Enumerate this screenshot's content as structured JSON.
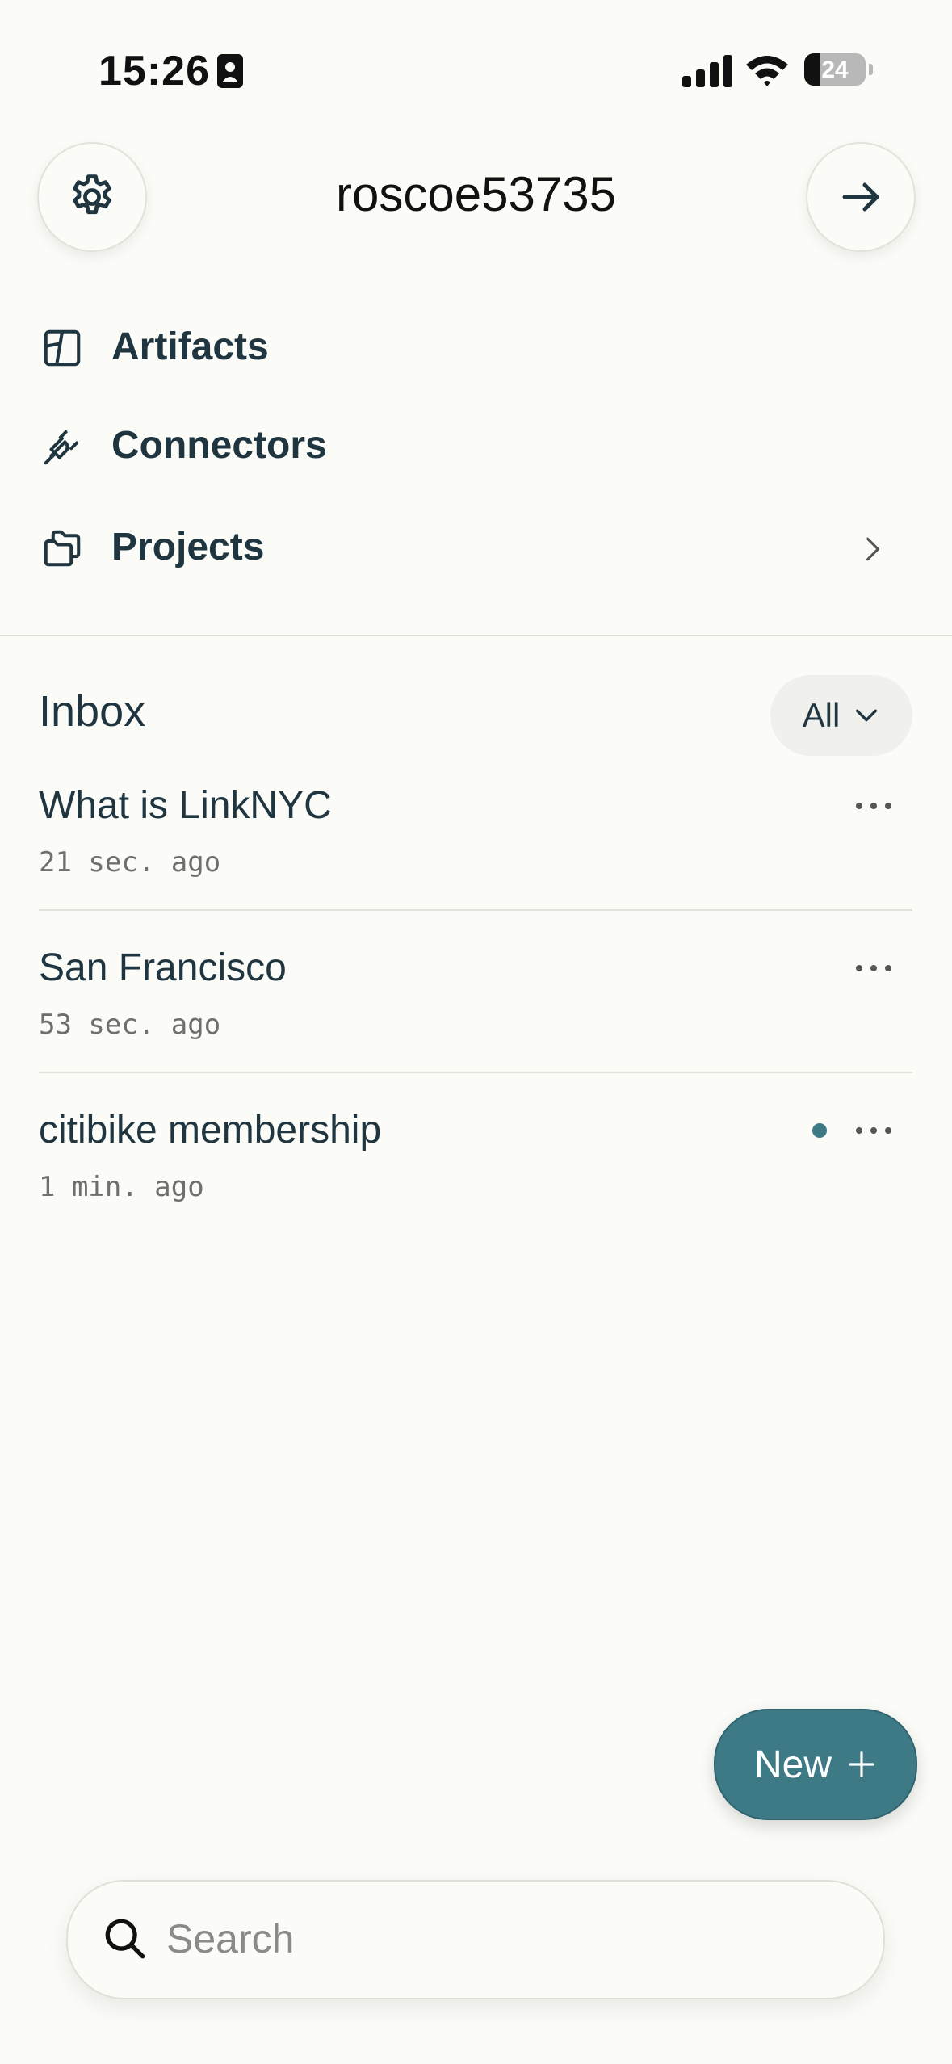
{
  "status_bar": {
    "time": "15:26",
    "battery": "24"
  },
  "header": {
    "username": "roscoe53735"
  },
  "nav": [
    {
      "label": "Artifacts",
      "icon": "artifacts-icon"
    },
    {
      "label": "Connectors",
      "icon": "plug-icon"
    },
    {
      "label": "Projects",
      "icon": "folders-icon"
    }
  ],
  "inbox": {
    "title": "Inbox",
    "filter": "All",
    "items": [
      {
        "title": "What is LinkNYC",
        "time": "21 sec. ago",
        "unread": false
      },
      {
        "title": "San Francisco",
        "time": "53 sec. ago",
        "unread": false
      },
      {
        "title": "citibike membership",
        "time": "1 min. ago",
        "unread": true
      }
    ]
  },
  "new_button": {
    "label": "New"
  },
  "search": {
    "placeholder": "Search",
    "value": ""
  },
  "colors": {
    "accent": "#3e7a86",
    "background": "#fbfbf7",
    "text": "#1f3540"
  }
}
